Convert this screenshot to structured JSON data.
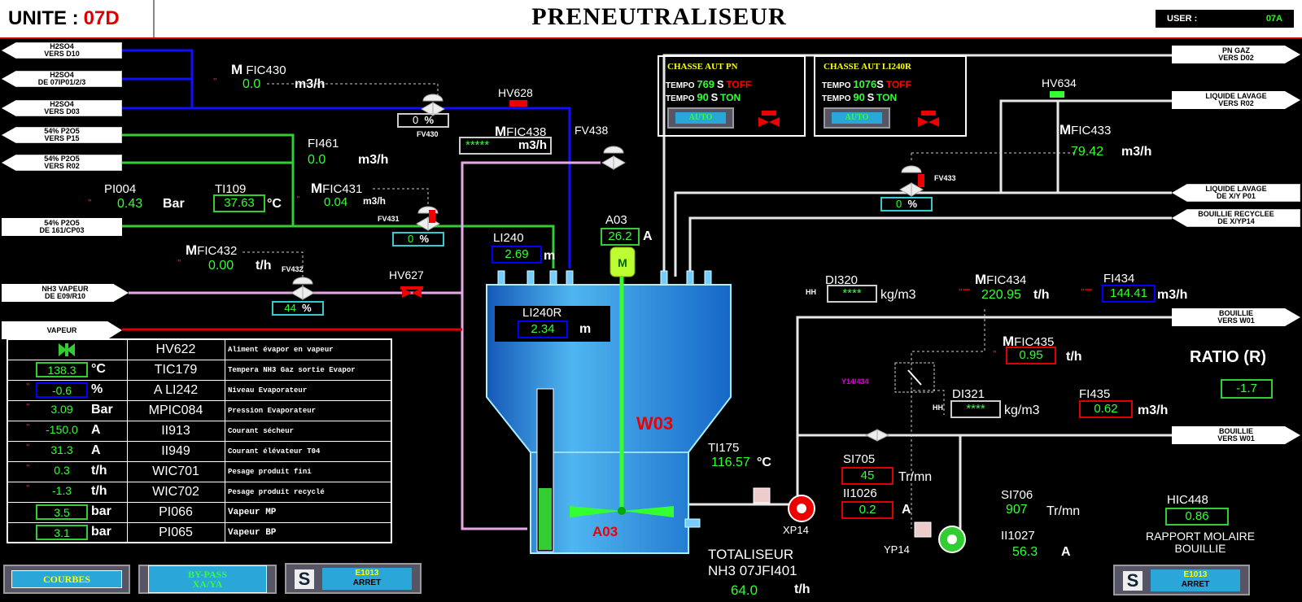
{
  "header": {
    "unit_label": "UNITE :",
    "unit_value": "07D",
    "title": "PRENEUTRALISEUR",
    "user_label": "USER :",
    "user_value": "07A"
  },
  "left_lines": [
    {
      "line1": "H2SO4",
      "line2": "VERS D10"
    },
    {
      "line1": "H2SO4",
      "line2": "DE 07IP01/2/3"
    },
    {
      "line1": "H2SO4",
      "line2": "VERS D03"
    },
    {
      "line1": "54% P2O5",
      "line2": "VERS P15"
    },
    {
      "line1": "54% P2O5",
      "line2": "VERS R02"
    },
    {
      "line1": "54% P2O5",
      "line2": "DE 161/CP03"
    },
    {
      "line1": "NH3 VAPEUR",
      "line2": "DE E09/R10"
    },
    {
      "line1": "VAPEUR",
      "line2": ""
    }
  ],
  "right_lines": [
    {
      "line1": "PN GAZ",
      "line2": "VERS D02"
    },
    {
      "line1": "LIQUIDE LAVAGE",
      "line2": "VERS R02"
    },
    {
      "line1": "LIQUIDE LAVAGE",
      "line2": "DE X/Y P01"
    },
    {
      "line1": "BOUILLIE RECYCLEE",
      "line2": "DE X/YP14"
    },
    {
      "line1": "BOUILLIE",
      "line2": "VERS W01"
    },
    {
      "line1": "BOUILLIE",
      "line2": "VERS W01"
    }
  ],
  "instruments": {
    "fic430": {
      "mode": "M",
      "tag": "FIC430",
      "value": "0.0",
      "unit": "m3/h"
    },
    "hv628": {
      "tag": "HV628"
    },
    "fv430": {
      "value": "0",
      "unit": "%",
      "tag": "FV430"
    },
    "fic438": {
      "mode": "M",
      "tag": "FIC438",
      "value": "*****",
      "unit": "m3/h"
    },
    "fv438": {
      "tag": "FV438"
    },
    "fi461": {
      "tag": "FI461",
      "value": "0.0",
      "unit": "m3/h"
    },
    "pi004": {
      "tag": "PI004",
      "value": "0.43",
      "unit": "Bar"
    },
    "ti109": {
      "tag": "TI109",
      "value": "37.63",
      "unit": "°C"
    },
    "fic431": {
      "mode": "M",
      "tag": "FIC431",
      "value": "0.04",
      "unit": "m3/h"
    },
    "fv431": {
      "tag": "FV431",
      "value": "0",
      "unit": "%"
    },
    "fic432": {
      "mode": "M",
      "tag": "FIC432",
      "value": "0.00",
      "unit": "t/h"
    },
    "fv432": {
      "tag": "FV432",
      "value": "44",
      "unit": "%"
    },
    "hv627": {
      "tag": "HV627"
    },
    "li240": {
      "tag": "LI240",
      "value": "2.69",
      "unit": "m"
    },
    "a03_top": {
      "tag": "A03",
      "value": "26.2",
      "unit": "A"
    },
    "li240r": {
      "tag": "LI240R",
      "value": "2.34",
      "unit": "m"
    },
    "w03": {
      "label": "W03"
    },
    "a03_bottom": {
      "label": "A03"
    },
    "ti175": {
      "tag": "TI175",
      "value": "116.57",
      "unit": "°C"
    },
    "xp14": {
      "tag": "XP14"
    },
    "yp14": {
      "tag": "YP14"
    },
    "di320": {
      "tag": "DI320",
      "prefix": "HH",
      "value": "****",
      "unit": "kg/m3"
    },
    "fic434": {
      "mode": "M",
      "tag": "FIC434",
      "value": "220.95",
      "unit": "t/h"
    },
    "fi434": {
      "tag": "FI434",
      "value": "144.41",
      "unit": "m3/h"
    },
    "fic435": {
      "mode": "M",
      "tag": "FIC435",
      "value": "0.95",
      "unit": "t/h"
    },
    "y14_434": {
      "tag": "Y14/434"
    },
    "di321": {
      "tag": "DI321",
      "prefix": "HH",
      "value": "****",
      "unit": "kg/m3"
    },
    "fi435": {
      "tag": "FI435",
      "value": "0.62",
      "unit": "m3/h"
    },
    "ratio": {
      "label": "RATIO (R)",
      "value": "-1.7"
    },
    "si705": {
      "tag": "SI705",
      "value": "45",
      "unit": "Tr/mn"
    },
    "ii1026": {
      "tag": "II1026",
      "value": "0.2",
      "unit": "A"
    },
    "si706": {
      "tag": "SI706",
      "value": "907",
      "unit": "Tr/mn"
    },
    "ii1027": {
      "tag": "II1027",
      "value": "56.3",
      "unit": "A"
    },
    "hic448": {
      "tag": "HIC448",
      "value": "0.86",
      "label1": "RAPPORT MOLAIRE",
      "label2": "BOUILLIE"
    },
    "fic433": {
      "mode": "M",
      "tag": "FIC433",
      "value": "79.42",
      "unit": "m3/h"
    },
    "fv433": {
      "tag": "FV433",
      "value": "0",
      "unit": "%"
    },
    "hv634": {
      "tag": "HV634"
    },
    "totaliseur": {
      "line1": "TOTALISEUR",
      "line2": "NH3 07JFI401",
      "value": "64.0",
      "unit": "t/h"
    }
  },
  "chasse_pn": {
    "title": "CHASSE AUT PN",
    "tempo_label": "TEMPO",
    "row1_value": "769",
    "row1_unit": "S",
    "row1_state": "TOFF",
    "row2_value": "90",
    "row2_unit": "S",
    "row2_state": "TON",
    "button": "AUTO"
  },
  "chasse_li": {
    "title": "CHASSE AUT LI240R",
    "tempo_label": "TEMPO",
    "row1_value": "1076",
    "row1_unit": "S",
    "row1_state": "TOFF",
    "row2_value": "90",
    "row2_unit": "S",
    "row2_state": "TON",
    "button": "AUTO"
  },
  "table": {
    "header_tag": "HV622",
    "header_desc": "Aliment évapor en vapeur",
    "rows": [
      {
        "alarm": "",
        "value": "138.3",
        "unit": "°C",
        "tag": "TIC179",
        "desc": "Tempera NH3 Gaz sortie Evapor"
      },
      {
        "alarm": "\"",
        "value": "-0.6",
        "unit": "%",
        "tag": "A LI242",
        "desc": "Niveau Evaporateur"
      },
      {
        "alarm": "\"",
        "value": "3.09",
        "unit": "Bar",
        "tag": "MPIC084",
        "desc": "Pression   Evaporateur"
      },
      {
        "alarm": "\"",
        "value": "-150.0",
        "unit": "A",
        "tag": "II913",
        "desc": "Courant sécheur"
      },
      {
        "alarm": "\"",
        "value": "31.3",
        "unit": "A",
        "tag": "II949",
        "desc": "Courant élévateur T04"
      },
      {
        "alarm": "\"",
        "value": "0.3",
        "unit": "t/h",
        "tag": "WIC701",
        "desc": "Pesage produit fini"
      },
      {
        "alarm": "\"",
        "value": "-1.3",
        "unit": "t/h",
        "tag": "WIC702",
        "desc": "Pesage produit recyclé"
      },
      {
        "alarm": "",
        "value": "3.5",
        "unit": "bar",
        "tag": "PI066",
        "desc": "Vapeur MP"
      },
      {
        "alarm": "",
        "value": "3.1",
        "unit": "bar",
        "tag": "PI065",
        "desc": "Vapeur BP"
      }
    ]
  },
  "buttons": {
    "courbes": "COURBES",
    "bypass_l1": "BY-PASS",
    "bypass_l2": "XA/YA",
    "e1013_left_title": "E1013",
    "e1013_left_state": "ARRET",
    "e1013_right_title": "E1013",
    "e1013_right_state": "ARRET",
    "s_letter": "S"
  },
  "colors": {
    "pipe_blue": "#1010ff",
    "pipe_green": "#3c3",
    "pipe_white": "#e8e8e8",
    "pipe_pink": "#e0a0e0",
    "pipe_red": "#d00",
    "tank": "#2e8ee0",
    "value_green": "#33ff33",
    "alarm_red": "#ff0000"
  }
}
